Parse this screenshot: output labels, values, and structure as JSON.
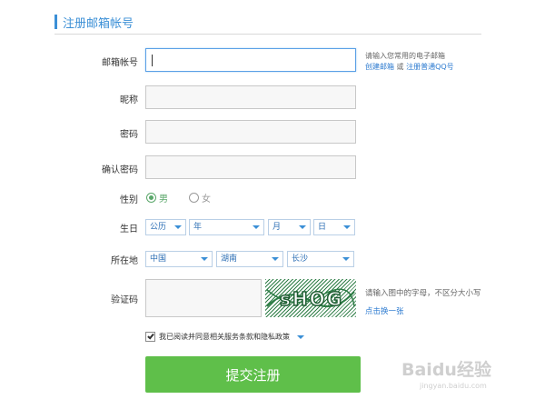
{
  "section": {
    "title": "注册邮箱帐号"
  },
  "colors": {
    "accent": "#3b8fd6",
    "submit": "#5fbf4a",
    "selected_radio": "#5aa76a",
    "link": "#2d7bd0"
  },
  "form": {
    "email": {
      "label": "邮箱帐号",
      "value": "",
      "hint_line1": "请输入您常用的电子邮箱",
      "hint_link1": "创建邮箱",
      "hint_or": "或",
      "hint_link2": "注册普通QQ号"
    },
    "nickname": {
      "label": "昵称",
      "value": ""
    },
    "password": {
      "label": "密码",
      "value": ""
    },
    "confirm_password": {
      "label": "确认密码",
      "value": ""
    },
    "gender": {
      "label": "性别",
      "male": "男",
      "female": "女",
      "selected": "男"
    },
    "birthday": {
      "label": "生日",
      "calendar": "公历",
      "year": "年",
      "month": "月",
      "day": "日"
    },
    "location": {
      "label": "所在地",
      "country": "中国",
      "province": "湖南",
      "city": "长沙"
    },
    "captcha": {
      "label": "验证码",
      "value": "",
      "image_text": "sHOG",
      "hint": "请输入图中的字母，不区分大小写",
      "refresh": "点击换一张"
    },
    "agreement": {
      "checked": true,
      "text": "我已阅读并同意相关服务条款和隐私政策"
    },
    "submit_label": "提交注册"
  },
  "watermark": {
    "brand": "Baidu经验",
    "url": "jingyan.baidu.com"
  }
}
